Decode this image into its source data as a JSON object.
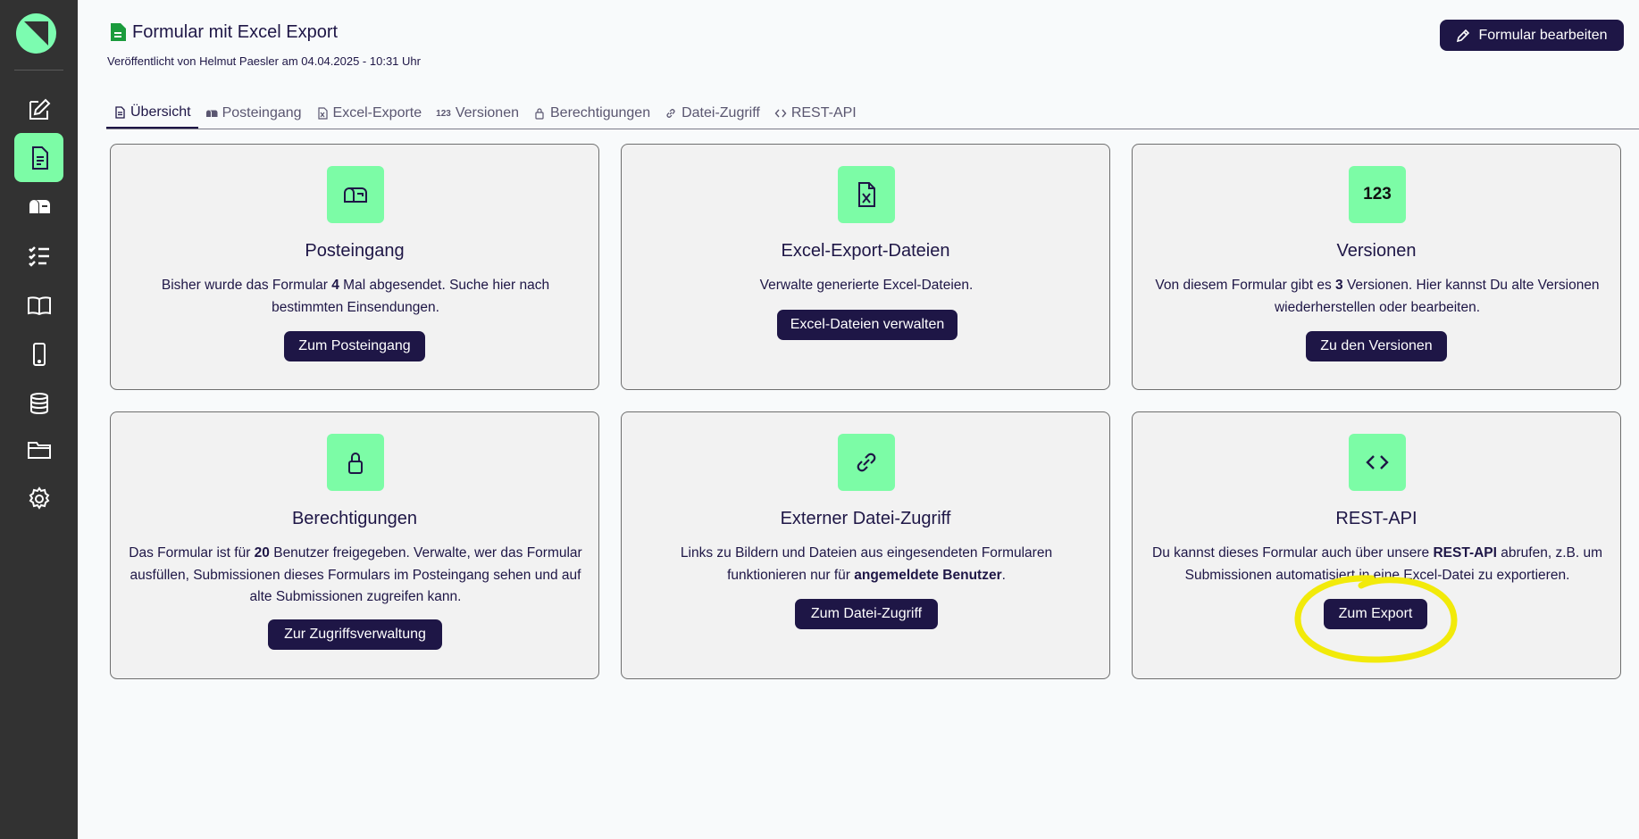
{
  "sidebar": {
    "items": [
      {
        "icon": "edit-form-icon"
      },
      {
        "icon": "document-icon",
        "active": true
      },
      {
        "icon": "mailbox-icon"
      },
      {
        "icon": "checklist-icon"
      },
      {
        "icon": "book-icon"
      },
      {
        "icon": "mobile-icon"
      },
      {
        "icon": "database-icon"
      },
      {
        "icon": "folder-icon"
      },
      {
        "icon": "gear-icon"
      }
    ]
  },
  "header": {
    "title": "Formular mit Excel Export",
    "subtitle": "Veröffentlicht von Helmut Paesler am 04.04.2025 - 10:31 Uhr",
    "edit_button": "Formular bearbeiten"
  },
  "tabs": [
    {
      "label": "Übersicht",
      "icon": "document-icon",
      "active": true
    },
    {
      "label": "Posteingang",
      "icon": "mailbox-icon"
    },
    {
      "label": "Excel-Exporte",
      "icon": "excel-file-icon"
    },
    {
      "label": "Versionen",
      "icon": "123",
      "icon_name": "number-123-icon"
    },
    {
      "label": "Berechtigungen",
      "icon": "lock-icon"
    },
    {
      "label": "Datei-Zugriff",
      "icon": "link-icon"
    },
    {
      "label": "REST-API",
      "icon": "code-icon"
    }
  ],
  "cards": {
    "posteingang": {
      "title": "Posteingang",
      "desc_a": "Bisher wurde das Formular ",
      "desc_b": "4",
      "desc_c": " Mal abgesendet. Suche hier nach bestimmten Einsendungen.",
      "button": "Zum Posteingang"
    },
    "excel": {
      "title": "Excel-Export-Dateien",
      "desc": "Verwalte generierte Excel-Dateien.",
      "button": "Excel-Dateien verwalten"
    },
    "versionen": {
      "title": "Versionen",
      "icon_text": "123",
      "desc_a": "Von diesem Formular gibt es ",
      "desc_b": "3",
      "desc_c": " Versionen. Hier kannst Du alte Versionen wiederherstellen oder bearbeiten.",
      "button": "Zu den Versionen"
    },
    "berechtigungen": {
      "title": "Berechtigungen",
      "desc_a": "Das Formular ist für ",
      "desc_b": "20",
      "desc_c": " Benutzer freigegeben. Verwalte, wer das Formular ausfüllen, Submissionen dieses Formulars im Posteingang sehen und auf alte Submissionen zugreifen kann.",
      "button": "Zur Zugriffsverwaltung"
    },
    "datei": {
      "title": "Externer Datei-Zugriff",
      "desc_a": "Links zu Bildern und Dateien aus eingesendeten Formularen funktionieren nur für ",
      "desc_b": "angemeldete Benutzer",
      "desc_c": ".",
      "button": "Zum Datei-Zugriff"
    },
    "rest": {
      "title": "REST-API",
      "desc_a": "Du kannst dieses Formular auch über unsere ",
      "desc_b": "REST-API",
      "desc_c": " abrufen, z.B. um Submissionen automatisiert in eine Excel-Datei zu exportieren.",
      "button": "Zum Export"
    }
  },
  "colors": {
    "sidebar_bg": "#323232",
    "accent_green": "#7cfca6",
    "button_bg": "#1e1646",
    "highlight": "#f2ea0a"
  }
}
